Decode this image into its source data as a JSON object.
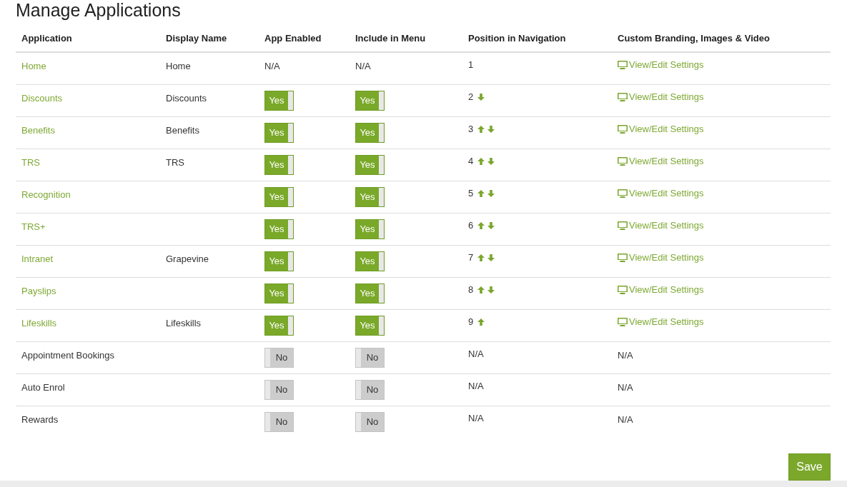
{
  "title": "Manage Applications",
  "table": {
    "columns": [
      "Application",
      "Display Name",
      "App Enabled",
      "Include in Menu",
      "Position in Navigation",
      "Custom Branding, Images & Video"
    ],
    "rows": [
      {
        "application": {
          "text": "Home",
          "linked": true
        },
        "display_name": "Home",
        "app_enabled": {
          "kind": "text",
          "text": "N/A"
        },
        "include_in_menu": {
          "kind": "text",
          "text": "N/A"
        },
        "position": {
          "text": "1",
          "up": false,
          "down": false
        },
        "branding": {
          "kind": "link",
          "text": "View/Edit Settings"
        }
      },
      {
        "application": {
          "text": "Discounts",
          "linked": true
        },
        "display_name": "Discounts",
        "app_enabled": {
          "kind": "toggle",
          "on": true,
          "label": "Yes"
        },
        "include_in_menu": {
          "kind": "toggle",
          "on": true,
          "label": "Yes"
        },
        "position": {
          "text": "2",
          "up": false,
          "down": true
        },
        "branding": {
          "kind": "link",
          "text": "View/Edit Settings"
        }
      },
      {
        "application": {
          "text": "Benefits",
          "linked": true
        },
        "display_name": "Benefits",
        "app_enabled": {
          "kind": "toggle",
          "on": true,
          "label": "Yes"
        },
        "include_in_menu": {
          "kind": "toggle",
          "on": true,
          "label": "Yes"
        },
        "position": {
          "text": "3",
          "up": true,
          "down": true
        },
        "branding": {
          "kind": "link",
          "text": "View/Edit Settings"
        }
      },
      {
        "application": {
          "text": "TRS",
          "linked": true
        },
        "display_name": "TRS",
        "app_enabled": {
          "kind": "toggle",
          "on": true,
          "label": "Yes"
        },
        "include_in_menu": {
          "kind": "toggle",
          "on": true,
          "label": "Yes"
        },
        "position": {
          "text": "4",
          "up": true,
          "down": true
        },
        "branding": {
          "kind": "link",
          "text": "View/Edit Settings"
        }
      },
      {
        "application": {
          "text": "Recognition",
          "linked": true
        },
        "app_enabled": {
          "kind": "toggle",
          "on": true,
          "label": "Yes"
        },
        "include_in_menu": {
          "kind": "toggle",
          "on": true,
          "label": "Yes"
        },
        "position": {
          "text": "5",
          "up": true,
          "down": true
        },
        "branding": {
          "kind": "link",
          "text": "View/Edit Settings"
        }
      },
      {
        "application": {
          "text": "TRS+",
          "linked": true
        },
        "app_enabled": {
          "kind": "toggle",
          "on": true,
          "label": "Yes"
        },
        "include_in_menu": {
          "kind": "toggle",
          "on": true,
          "label": "Yes"
        },
        "position": {
          "text": "6",
          "up": true,
          "down": true
        },
        "branding": {
          "kind": "link",
          "text": "View/Edit Settings"
        }
      },
      {
        "application": {
          "text": "Intranet",
          "linked": true
        },
        "display_name": "Grapevine",
        "app_enabled": {
          "kind": "toggle",
          "on": true,
          "label": "Yes"
        },
        "include_in_menu": {
          "kind": "toggle",
          "on": true,
          "label": "Yes"
        },
        "position": {
          "text": "7",
          "up": true,
          "down": true
        },
        "branding": {
          "kind": "link",
          "text": "View/Edit Settings"
        }
      },
      {
        "application": {
          "text": "Payslips",
          "linked": true
        },
        "app_enabled": {
          "kind": "toggle",
          "on": true,
          "label": "Yes"
        },
        "include_in_menu": {
          "kind": "toggle",
          "on": true,
          "label": "Yes"
        },
        "position": {
          "text": "8",
          "up": true,
          "down": true
        },
        "branding": {
          "kind": "link",
          "text": "View/Edit Settings"
        }
      },
      {
        "application": {
          "text": "Lifeskills",
          "linked": true
        },
        "display_name": "Lifeskills",
        "app_enabled": {
          "kind": "toggle",
          "on": true,
          "label": "Yes"
        },
        "include_in_menu": {
          "kind": "toggle",
          "on": true,
          "label": "Yes"
        },
        "position": {
          "text": "9",
          "up": true,
          "down": false
        },
        "branding": {
          "kind": "link",
          "text": "View/Edit Settings"
        }
      },
      {
        "application": {
          "text": "Appointment Bookings",
          "linked": false
        },
        "app_enabled": {
          "kind": "toggle",
          "on": false,
          "label": "No"
        },
        "include_in_menu": {
          "kind": "toggle",
          "on": false,
          "label": "No"
        },
        "position": {
          "text": "N/A",
          "up": false,
          "down": false
        },
        "branding": {
          "kind": "text",
          "text": "N/A"
        }
      },
      {
        "application": {
          "text": "Auto Enrol",
          "linked": false
        },
        "app_enabled": {
          "kind": "toggle",
          "on": false,
          "label": "No"
        },
        "include_in_menu": {
          "kind": "toggle",
          "on": false,
          "label": "No"
        },
        "position": {
          "text": "N/A",
          "up": false,
          "down": false
        },
        "branding": {
          "kind": "text",
          "text": "N/A"
        }
      },
      {
        "application": {
          "text": "Rewards",
          "linked": false
        },
        "app_enabled": {
          "kind": "toggle",
          "on": false,
          "label": "No"
        },
        "include_in_menu": {
          "kind": "toggle",
          "on": false,
          "label": "No"
        },
        "position": {
          "text": "N/A",
          "up": false,
          "down": false
        },
        "branding": {
          "kind": "text",
          "text": "N/A"
        }
      }
    ]
  },
  "save_button": "Save"
}
